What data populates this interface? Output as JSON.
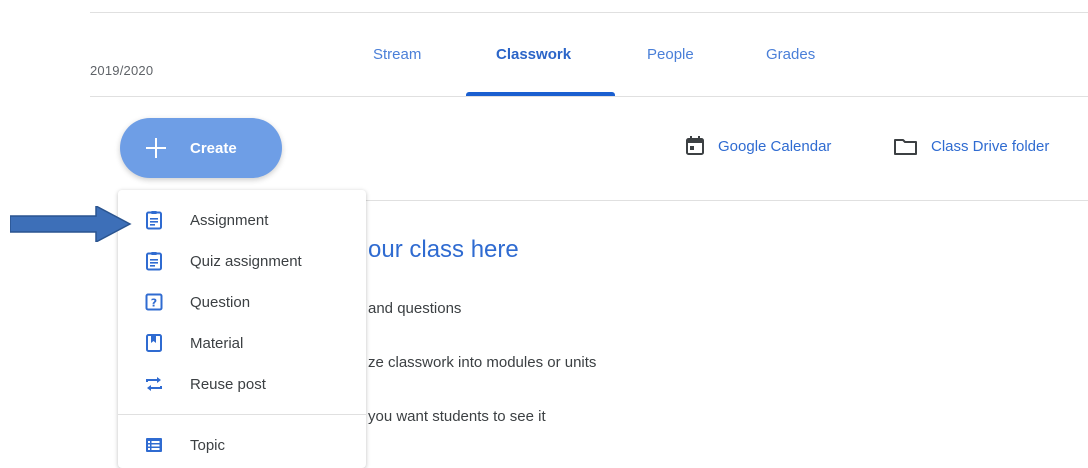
{
  "header": {
    "year": "2019/2020"
  },
  "tabs": [
    {
      "label": "Stream",
      "active": false
    },
    {
      "label": "Classwork",
      "active": true
    },
    {
      "label": "People",
      "active": false
    },
    {
      "label": "Grades",
      "active": false
    }
  ],
  "create": {
    "label": "Create"
  },
  "links": {
    "calendar": "Google Calendar",
    "drive": "Class Drive folder"
  },
  "hero": {
    "title": "our class here",
    "line1": "and questions",
    "line2": "ze classwork into modules or units",
    "line3": "you want students to see it"
  },
  "menu": {
    "items": [
      {
        "label": "Assignment",
        "icon": "assignment-icon"
      },
      {
        "label": "Quiz assignment",
        "icon": "quiz-assignment-icon"
      },
      {
        "label": "Question",
        "icon": "question-icon"
      },
      {
        "label": "Material",
        "icon": "material-icon"
      },
      {
        "label": "Reuse post",
        "icon": "reuse-post-icon"
      },
      {
        "label": "Topic",
        "icon": "topic-icon"
      }
    ]
  },
  "colors": {
    "accent": "#2f6bd1",
    "create_button": "#6e9ee6",
    "arrow": "#3d6fb8"
  }
}
